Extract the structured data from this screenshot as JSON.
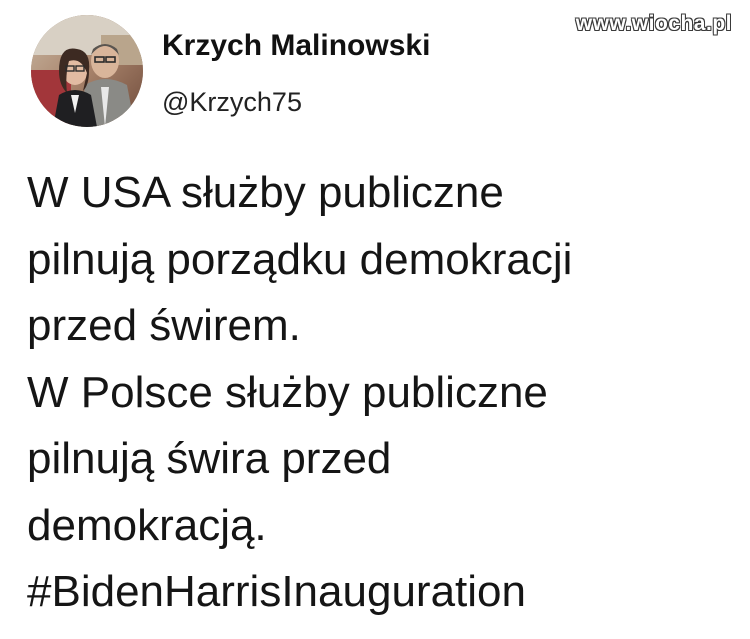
{
  "author": {
    "name": "Krzych Malinowski",
    "handle": "@Krzych75",
    "avatar_icon": "profile-photo-avatar"
  },
  "watermark": {
    "text": "www.wiocha.pl"
  },
  "tweet": {
    "lines": [
      "W USA służby publiczne",
      "pilnują porządku demokracji",
      "przed świrem.",
      "W Polsce służby publiczne",
      "pilnują świra przed",
      "demokracją."
    ],
    "hashtag": "#BidenHarrisInauguration"
  },
  "colors": {
    "background": "#ffffff",
    "text": "#151515"
  }
}
